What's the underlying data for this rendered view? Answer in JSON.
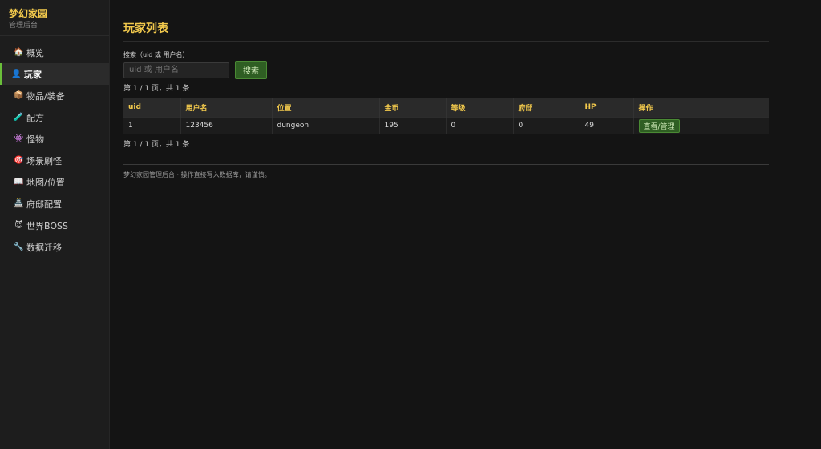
{
  "sidebar": {
    "brand_title": "梦幻家园",
    "brand_sub": "管理后台",
    "items": [
      {
        "icon": "🏠",
        "label": "概览",
        "active": false
      },
      {
        "icon": "👤",
        "label": "玩家",
        "active": true
      },
      {
        "icon": "📦",
        "label": "物品/装备",
        "active": false
      },
      {
        "icon": "🧪",
        "label": "配方",
        "active": false
      },
      {
        "icon": "👾",
        "label": "怪物",
        "active": false
      },
      {
        "icon": "🎯",
        "label": "场景刷怪",
        "active": false
      },
      {
        "icon": "📖",
        "label": "地图/位置",
        "active": false
      },
      {
        "icon": "🏯",
        "label": "府邸配置",
        "active": false
      },
      {
        "icon": "😈",
        "label": "世界BOSS",
        "active": false
      },
      {
        "icon": "🔧",
        "label": "数据迁移",
        "active": false
      }
    ]
  },
  "main": {
    "title": "玩家列表",
    "search_label": "搜索（uid 或 用户名）",
    "search_placeholder": "uid 或 用户名",
    "search_button": "搜索",
    "pager_top": "第 1 / 1 页，共 1 条",
    "pager_bottom": "第 1 / 1 页，共 1 条",
    "table": {
      "headers": [
        "uid",
        "用户名",
        "位置",
        "金币",
        "等级",
        "府邸",
        "HP",
        "操作"
      ],
      "rows": [
        {
          "uid": "1",
          "username": "123456",
          "location": "dungeon",
          "gold": "195",
          "level": "0",
          "mansion": "0",
          "hp": "49",
          "action": "查看/管理"
        }
      ]
    },
    "footer": "梦幻家园管理后台 · 操作直接写入数据库，请谨慎。"
  },
  "colors": {
    "accent": "#f2c94c",
    "active_bar": "#6abf3a",
    "button_bg": "#2f5e23"
  }
}
